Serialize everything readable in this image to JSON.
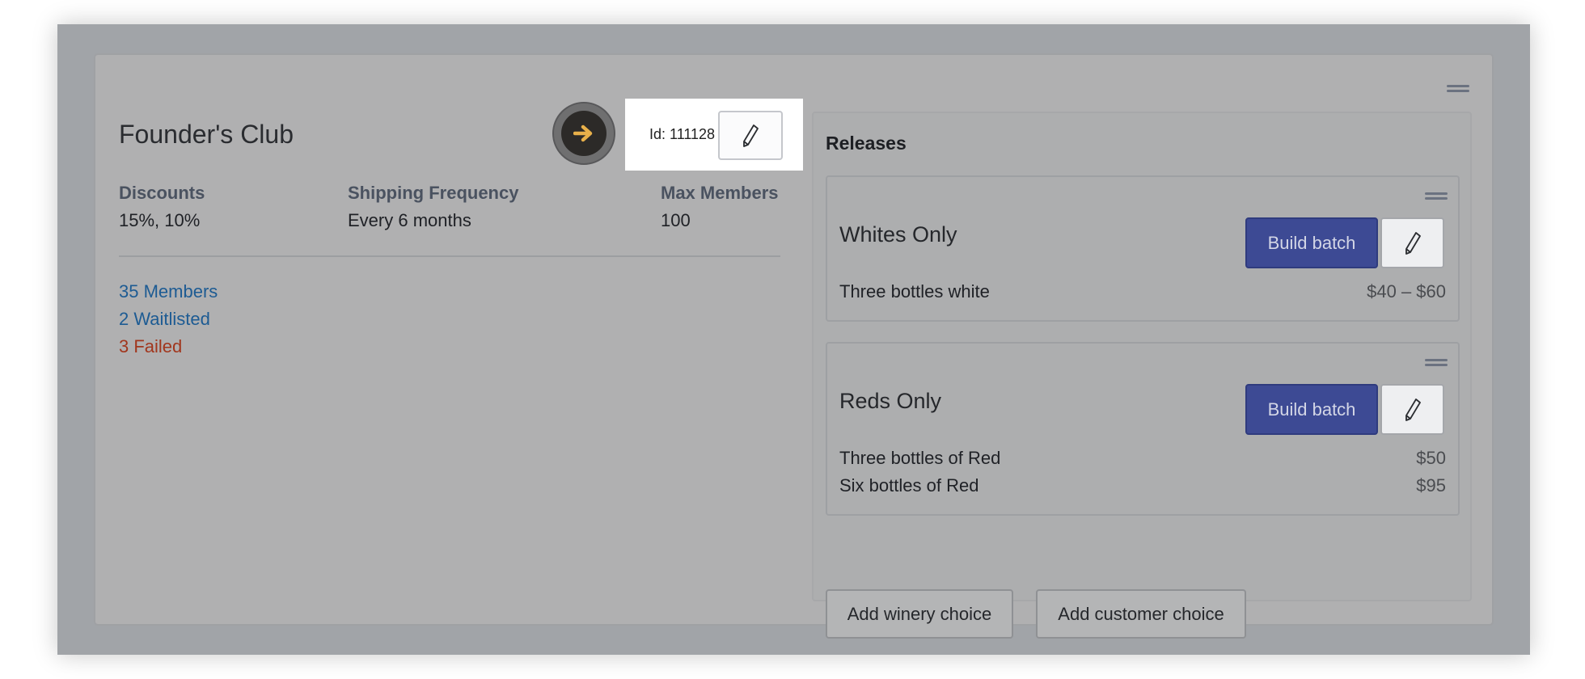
{
  "club": {
    "title": "Founder's Club",
    "id_label": "Id: 111128",
    "stats": [
      {
        "label": "Discounts",
        "value": "15%, 10%"
      },
      {
        "label": "Shipping Frequency",
        "value": "Every 6 months"
      },
      {
        "label": "Max Members",
        "value": "100"
      }
    ],
    "links": {
      "members": "35 Members",
      "waitlisted": "2 Waitlisted",
      "failed": "3 Failed"
    }
  },
  "releases": {
    "title": "Releases",
    "items": [
      {
        "name": "Whites Only",
        "build_label": "Build batch",
        "options": [
          {
            "name": "Three bottles white",
            "price": "$40 – $60"
          }
        ]
      },
      {
        "name": "Reds Only",
        "build_label": "Build batch",
        "options": [
          {
            "name": "Three bottles of Red",
            "price": "$50"
          },
          {
            "name": "Six bottles of Red",
            "price": "$95"
          }
        ]
      }
    ],
    "add_winery_choice": "Add winery choice",
    "add_customer_choice": "Add customer choice"
  },
  "icons": {
    "go": "arrow-right-icon",
    "edit": "pencil-icon",
    "drag": "drag-handle-icon"
  },
  "colors": {
    "primary_button": "#3d4a94",
    "link_blue": "#1d5b93",
    "link_red": "#a1361d",
    "arrow_accent": "#e8b04a",
    "overlay": "#a1a4a8"
  }
}
